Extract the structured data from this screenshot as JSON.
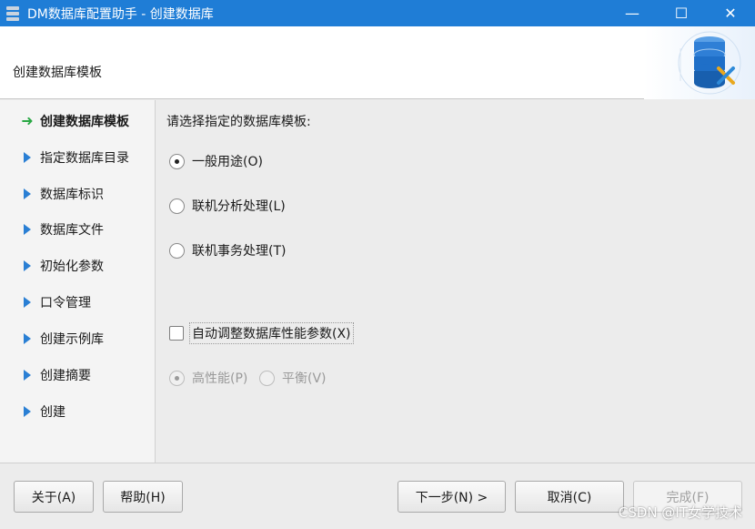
{
  "window": {
    "title": "DM数据库配置助手 - 创建数据库",
    "minimize_glyph": "—",
    "maximize_glyph": "☐",
    "close_glyph": "✕"
  },
  "header": {
    "heading": "创建数据库模板"
  },
  "steps": [
    {
      "label": "创建数据库模板",
      "active": true
    },
    {
      "label": "指定数据库目录",
      "active": false
    },
    {
      "label": "数据库标识",
      "active": false
    },
    {
      "label": "数据库文件",
      "active": false
    },
    {
      "label": "初始化参数",
      "active": false
    },
    {
      "label": "口令管理",
      "active": false
    },
    {
      "label": "创建示例库",
      "active": false
    },
    {
      "label": "创建摘要",
      "active": false
    },
    {
      "label": "创建",
      "active": false
    }
  ],
  "content": {
    "prompt": "请选择指定的数据库模板:",
    "options": [
      {
        "label": "一般用途(O)",
        "checked": true
      },
      {
        "label": "联机分析处理(L)",
        "checked": false
      },
      {
        "label": "联机事务处理(T)",
        "checked": false
      }
    ],
    "auto_tune": {
      "label": "自动调整数据库性能参数(X)",
      "checked": false
    },
    "performance": [
      {
        "label": "高性能(P)",
        "checked": true,
        "disabled": true
      },
      {
        "label": "平衡(V)",
        "checked": false,
        "disabled": true
      }
    ]
  },
  "footer": {
    "about": "关于(A)",
    "help": "帮助(H)",
    "next": "下一步(N) >",
    "cancel": "取消(C)",
    "finish": "完成(F)",
    "watermark": "CSDN @IT女学技术"
  },
  "colors": {
    "titlebar": "#1f7dd6",
    "active_arrow": "#2aa845",
    "step_marker": "#2a7fd4"
  }
}
